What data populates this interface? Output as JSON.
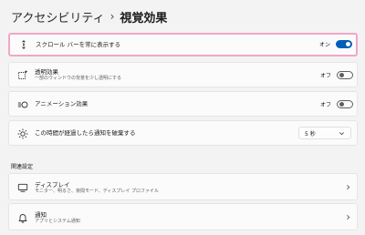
{
  "header": {
    "parent": "アクセシビリティ",
    "separator": "›",
    "current": "視覚効果"
  },
  "settings": [
    {
      "title": "スクロール バーを常に表示する",
      "icon": "scrollbar-icon",
      "state_label": "オン",
      "on": true
    },
    {
      "title": "透明効果",
      "subtitle": "一部のウィンドウの背景を少し透明にする",
      "icon": "transparency-icon",
      "state_label": "オフ",
      "on": false
    },
    {
      "title": "アニメーション効果",
      "icon": "animation-icon",
      "state_label": "オフ",
      "on": false
    },
    {
      "title": "この時間が経過したら通知を破棄する",
      "icon": "notification-timer-icon",
      "dropdown_value": "5 秒"
    }
  ],
  "related": {
    "label": "関連設定",
    "items": [
      {
        "title": "ディスプレイ",
        "subtitle": "モニター、明るさ、夜間モード、ディスプレイ プロファイル",
        "icon": "display-icon"
      },
      {
        "title": "通知",
        "subtitle": "アプリとシステム通知",
        "icon": "bell-icon"
      }
    ]
  },
  "colors": {
    "accent": "#005fb8",
    "highlight": "#f2a6c7",
    "background": "#f3f3f3"
  }
}
